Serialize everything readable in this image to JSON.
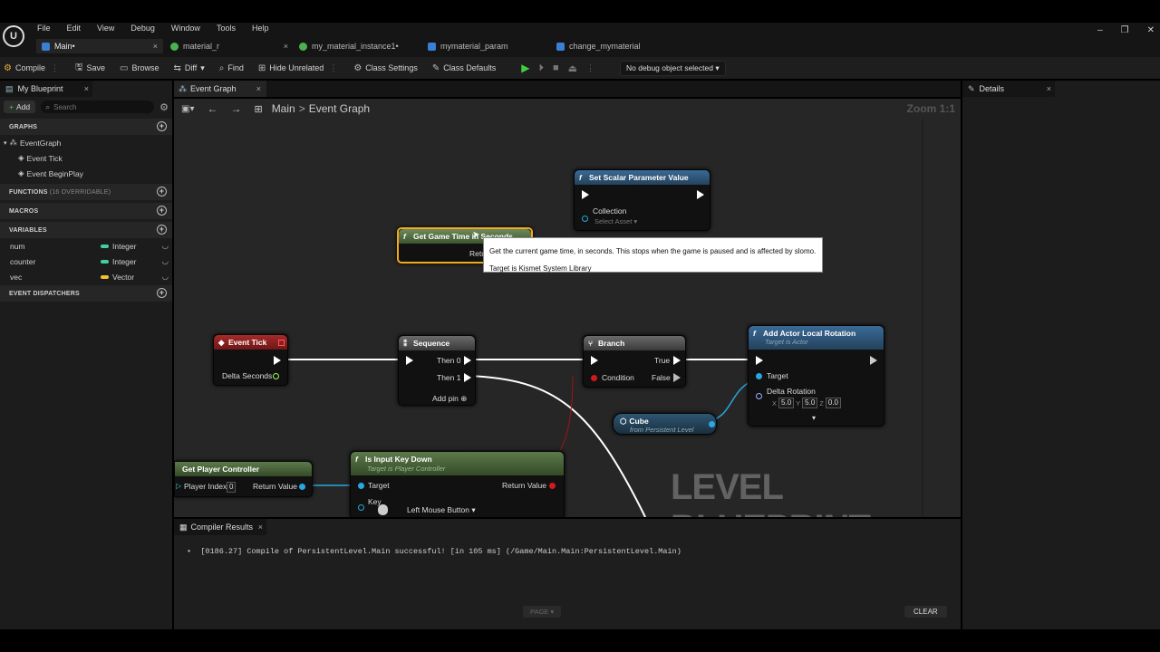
{
  "menu": [
    "File",
    "Edit",
    "View",
    "Debug",
    "Window",
    "Tools",
    "Help"
  ],
  "tabs": [
    {
      "label": "Main•",
      "close": "×"
    },
    {
      "label": "material_r",
      "close": "×"
    },
    {
      "label": "my_material_instance1•"
    },
    {
      "label": "mymaterial_param"
    },
    {
      "label": "change_mymaterial"
    }
  ],
  "toolbar": {
    "compile": "Compile",
    "save": "Save",
    "browse": "Browse",
    "diff": "Diff",
    "find": "Find",
    "hide_unrelated": "Hide Unrelated",
    "class_settings": "Class Settings",
    "class_defaults": "Class Defaults",
    "debug_object": "No debug object selected"
  },
  "left": {
    "title": "My Blueprint",
    "add": "Add",
    "search_placeholder": "Search",
    "graphs": "GRAPHS",
    "event_graph": "EventGraph",
    "event_tick": "Event Tick",
    "event_beginplay": "Event BeginPlay",
    "functions": "FUNCTIONS",
    "functions_note": "(16 OVERRIDABLE)",
    "macros": "MACROS",
    "variables": "VARIABLES",
    "vars": [
      {
        "name": "num",
        "type": "Integer",
        "color": "#3fd1a0"
      },
      {
        "name": "counter",
        "type": "Integer",
        "color": "#3fd1a0"
      },
      {
        "name": "vec",
        "type": "Vector",
        "color": "#f2c22f"
      }
    ],
    "dispatchers": "EVENT DISPATCHERS"
  },
  "graph": {
    "tab": "Event Graph",
    "crumb_main": "Main",
    "crumb_sep": ">",
    "crumb_graph": "Event Graph",
    "zoom": "Zoom 1:1",
    "watermark": "LEVEL BLUEPRINT",
    "tooltip_line1": "Get the current game time, in seconds. This stops when the game is paused and is affected by slomo.",
    "tooltip_line2": "Target is Kismet System Library",
    "nodes": {
      "set_scalar": {
        "title": "Set Scalar Parameter Value",
        "collection": "Collection",
        "select": "Select Asset"
      },
      "get_game_time": {
        "title": "Get Game Time in Seconds",
        "ret": "Retu"
      },
      "event_tick": {
        "title": "Event Tick",
        "delta": "Delta Seconds"
      },
      "sequence": {
        "title": "Sequence",
        "then0": "Then 0",
        "then1": "Then 1",
        "addpin": "Add pin"
      },
      "branch": {
        "title": "Branch",
        "cond": "Condition",
        "true": "True",
        "false": "False"
      },
      "add_rot": {
        "title": "Add Actor Local Rotation",
        "sub": "Target is Actor",
        "target": "Target",
        "delta": "Delta Rotation",
        "x": "5.0",
        "y": "5.0",
        "z": "0.0"
      },
      "cube": {
        "title": "Cube",
        "sub": "from Persistent Level"
      },
      "get_pc": {
        "title": "Get Player Controller",
        "player_index": "Player Index",
        "idx": "0",
        "ret": "Return Value"
      },
      "input_key": {
        "title": "Is Input Key Down",
        "sub": "Target is Player Controller",
        "target": "Target",
        "key": "Key",
        "ret": "Return Value",
        "keyval": "Left Mouse Button"
      }
    }
  },
  "compiler": {
    "title": "Compiler Results",
    "message": "[0186.27] Compile of PersistentLevel.Main successful! [in 105 ms] (/Game/Main.Main:PersistentLevel.Main)",
    "page": "PAGE",
    "clear": "CLEAR"
  },
  "details": {
    "title": "Details"
  }
}
